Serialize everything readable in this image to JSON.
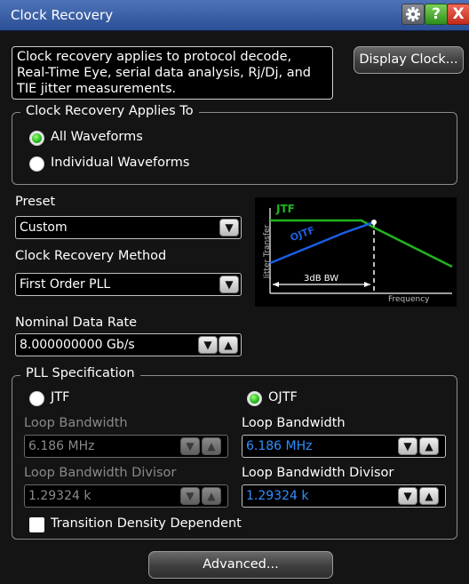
{
  "window": {
    "title": "Clock Recovery"
  },
  "description": "Clock recovery applies to protocol decode, Real-Time Eye, serial data analysis, Rj/Dj, and TIE jitter measurements.",
  "display_clock_label": "Display Clock...",
  "applies_to": {
    "legend": "Clock Recovery Applies To",
    "options": [
      {
        "label": "All Waveforms",
        "selected": true
      },
      {
        "label": "Individual Waveforms",
        "selected": false
      }
    ]
  },
  "preset": {
    "label": "Preset",
    "value": "Custom"
  },
  "method": {
    "label": "Clock Recovery Method",
    "value": "First Order PLL"
  },
  "graph": {
    "jtf_label": "JTF",
    "ojtf_label": "OJTF",
    "y_label": "Jitter Transfer",
    "x_label": "Frequency",
    "bw_label": "3dB BW",
    "colors": {
      "jtf": "#1fb51f",
      "ojtf": "#1a5fe6"
    }
  },
  "nominal_rate": {
    "label": "Nominal Data Rate",
    "value": "8.000000000 Gb/s"
  },
  "pll": {
    "legend": "PLL Specification",
    "jtf": {
      "label": "JTF",
      "loop_bw_label": "Loop Bandwidth",
      "loop_bw_value": "6.186 MHz",
      "divisor_label": "Loop Bandwidth Divisor",
      "divisor_value": "1.29324 k"
    },
    "ojtf": {
      "label": "OJTF",
      "loop_bw_label": "Loop Bandwidth",
      "loop_bw_value": "6.186 MHz",
      "divisor_label": "Loop Bandwidth Divisor",
      "divisor_value": "1.29324 k"
    },
    "transition_density_label": "Transition Density Dependent"
  },
  "advanced_label": "Advanced...",
  "icons": {
    "settings": "gear-icon",
    "help": "help-icon",
    "close": "close-icon",
    "down": "chevron-down-icon",
    "up": "chevron-up-icon"
  }
}
